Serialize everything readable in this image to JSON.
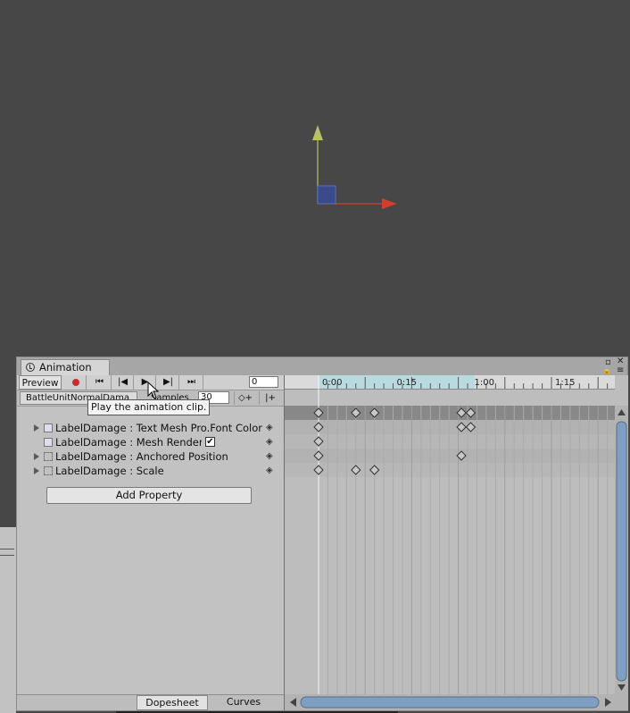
{
  "window": {
    "tab_title": "Animation",
    "controls": [
      "▫",
      "✕",
      "🔒",
      "≡"
    ]
  },
  "toolbar": {
    "preview_label": "Preview",
    "record_icon": "record-icon",
    "first_key_icon": "⏮",
    "prev_key_icon": "|◀",
    "play_icon": "▶",
    "next_key_icon": "▶|",
    "last_key_icon": "⏭",
    "frame_value": "0"
  },
  "clip": {
    "name": "BattleUnitNormalDama",
    "samples_label": "Samples",
    "samples_value": "30",
    "add_keyframe_icon": "◇+",
    "add_event_icon": "|+"
  },
  "tooltip": "Play the animation clip.",
  "properties": [
    {
      "label": "LabelDamage : Text Mesh Pro.Font Color",
      "expandable": true,
      "icon": "text-component-icon"
    },
    {
      "label": "LabelDamage : Mesh Render",
      "expandable": false,
      "icon": "mesh-renderer-icon",
      "checkbox": "✔"
    },
    {
      "label": "LabelDamage : Anchored Position",
      "expandable": true,
      "icon": "rect-transform-icon"
    },
    {
      "label": "LabelDamage : Scale",
      "expandable": true,
      "icon": "rect-transform-icon"
    }
  ],
  "add_property_label": "Add Property",
  "timeline": {
    "ruler_labels": [
      "0:00",
      "0:15",
      "1:00",
      "1:15"
    ],
    "summary_keys": [
      0,
      12,
      18,
      46,
      49
    ],
    "tracks": [
      {
        "keys": [
          0,
          46,
          49
        ]
      },
      {
        "keys": [
          0
        ]
      },
      {
        "keys": [
          0,
          46
        ]
      },
      {
        "keys": [
          0,
          12,
          18
        ]
      }
    ]
  },
  "bottom_tabs": [
    "Dopesheet",
    "Curves"
  ],
  "colors": {
    "scene_bg": "#474747",
    "panel_bg": "#c2c2c2",
    "record": "#c23030",
    "gizmo_y": "#b5c26a",
    "gizmo_x": "#d0402a",
    "gizmo_center": "#3a4a8a"
  }
}
